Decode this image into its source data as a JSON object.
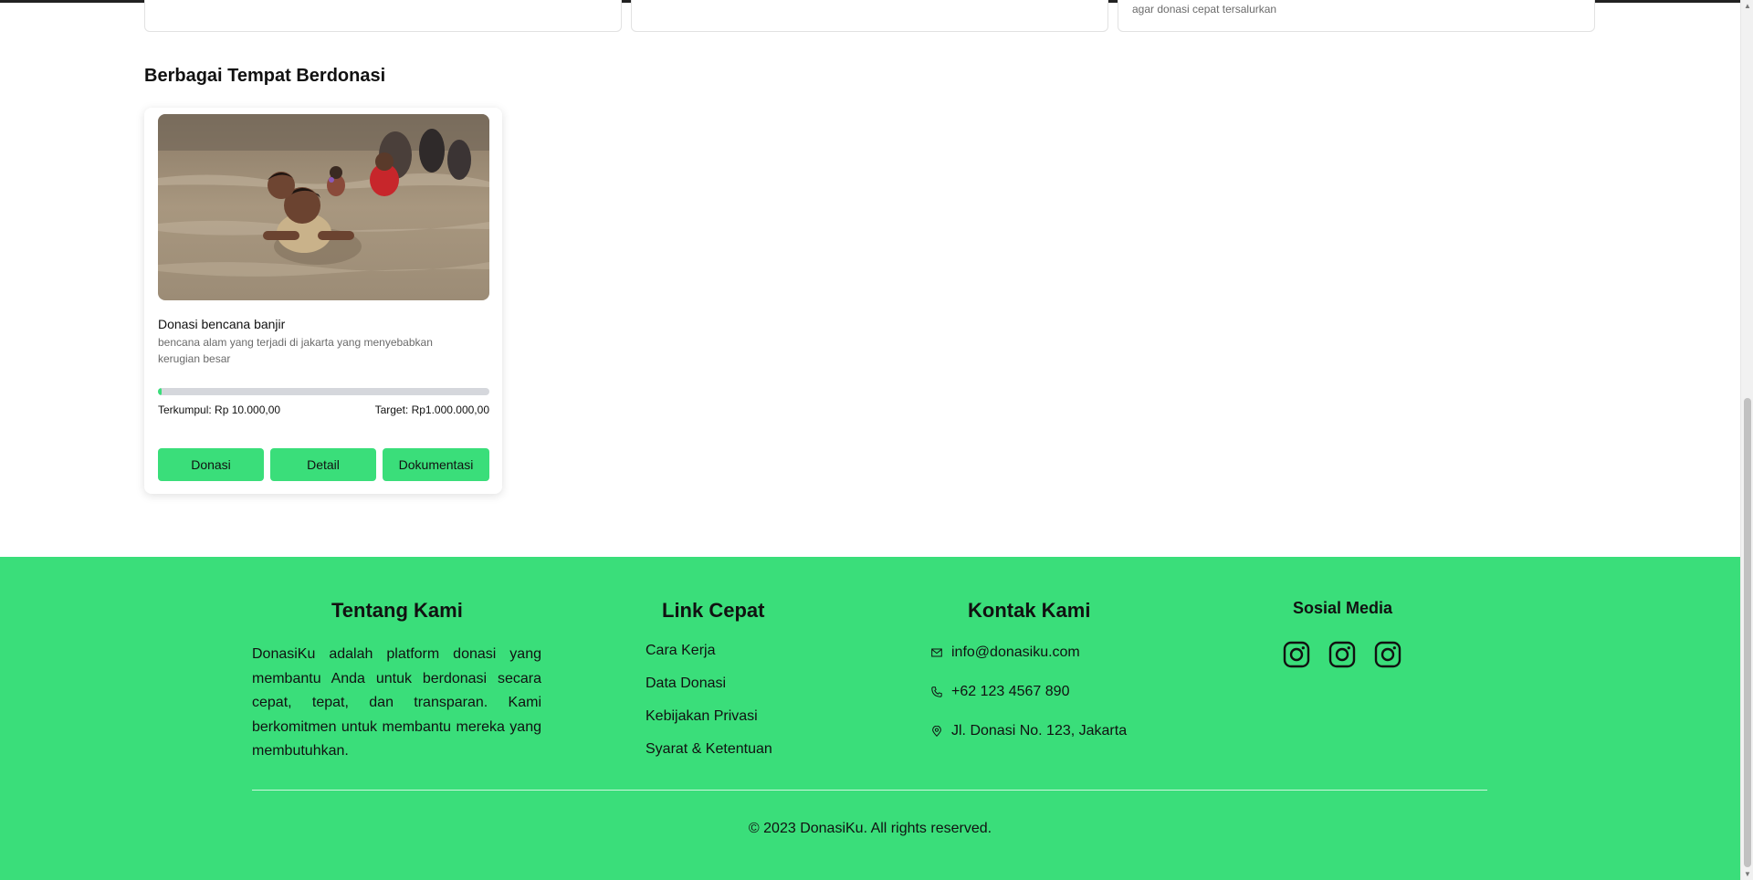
{
  "top_cards": [
    {
      "description": ""
    },
    {
      "description": ""
    },
    {
      "description": "agar donasi cepat tersalurkan"
    }
  ],
  "section": {
    "title": "Berbagai Tempat Berdonasi"
  },
  "card": {
    "title": "Donasi bencana banjir",
    "description": "bencana alam yang terjadi di jakarta yang menyebabkan kerugian besar",
    "collected_label": "Terkumpul: Rp 10.000,00",
    "target_label": "Target: Rp1.000.000,00",
    "progress_percent": 1,
    "buttons": {
      "donate": "Donasi",
      "detail": "Detail",
      "documentation": "Dokumentasi"
    }
  },
  "footer": {
    "about": {
      "title": "Tentang Kami",
      "text": "DonasiKu adalah platform donasi yang membantu Anda untuk berdonasi secara cepat, tepat, dan transparan. Kami berkomitmen untuk membantu mereka yang membutuhkan."
    },
    "links": {
      "title": "Link Cepat",
      "items": [
        "Cara Kerja",
        "Data Donasi",
        "Kebijakan Privasi",
        "Syarat & Ketentuan"
      ]
    },
    "contact": {
      "title": "Kontak Kami",
      "email": "info@donasiku.com",
      "phone": "+62 123 4567 890",
      "address": "Jl. Donasi No. 123, Jakarta"
    },
    "social": {
      "title": "Sosial Media",
      "icons": [
        "instagram-icon",
        "instagram-icon",
        "instagram-icon"
      ]
    },
    "copyright": "© 2023 DonasiKu. All rights reserved."
  },
  "colors": {
    "accent": "#3ade7a",
    "progress_track": "#d5d7dc"
  }
}
